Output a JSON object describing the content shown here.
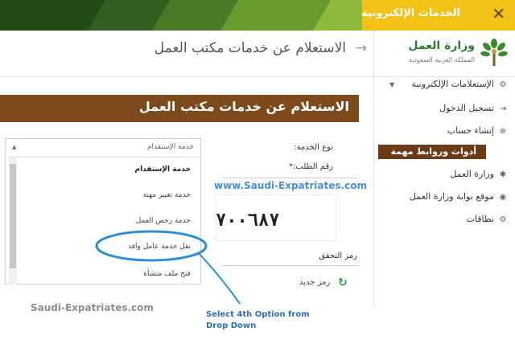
{
  "topbar": {
    "title": "الخدمات الإلكترونية",
    "close_label": "✕"
  },
  "logo": {
    "name": "وزارة العمل",
    "subtitle": "المملكة العربية السعودية"
  },
  "header": {
    "title": "الاستعلام عن خدمات مكتب العمل",
    "back_icon": "arrow-right-icon"
  },
  "sidebar": {
    "items": [
      {
        "label": "الإستعلامات الإلكترونية",
        "icon": "gears-icon"
      },
      {
        "label": "تسجيل الدخول",
        "icon": "login-icon"
      },
      {
        "label": "إنشاء حساب",
        "icon": "plus-circle-icon"
      },
      {
        "label": "أدوات وروابط مهمة",
        "icon": "none",
        "active": true
      },
      {
        "label": "وزارة العمل",
        "icon": "palm-icon"
      },
      {
        "label": "موقع بوابة وزارة العمل",
        "icon": "globe-icon"
      },
      {
        "label": "نطاقات",
        "icon": "gear-icon"
      }
    ]
  },
  "content": {
    "title": "الاستعلام عن خدمات مكتب العمل",
    "service_type_label": "نوع الخدمة:",
    "request_number_label": "رقم الطلب:*",
    "captcha_label": "رمز التحقق",
    "captcha_value": "٧٠٠٦٨٧",
    "refresh_label": "رمز جديد"
  },
  "dropdown": {
    "selected": "خدمة الإستقدام",
    "options": [
      "خدمة الإستقدام",
      "خدمة تغيير مهنة",
      "خدمة رخص العمل",
      "نقل خدمة عامل وافد",
      "فتح ملف منشأة"
    ]
  },
  "watermarks": {
    "blue": "www.Saudi-Expatriates.com",
    "gray": "Saudi-Expatriates.com"
  },
  "annotation": {
    "note_line1": "Select 4th Option from",
    "note_line2": "Drop Down"
  },
  "colors": {
    "brown": "#7c4a1b",
    "yellow": "#f2c316",
    "green": "#2e5a1c",
    "annotation": "#2e8fd6"
  }
}
